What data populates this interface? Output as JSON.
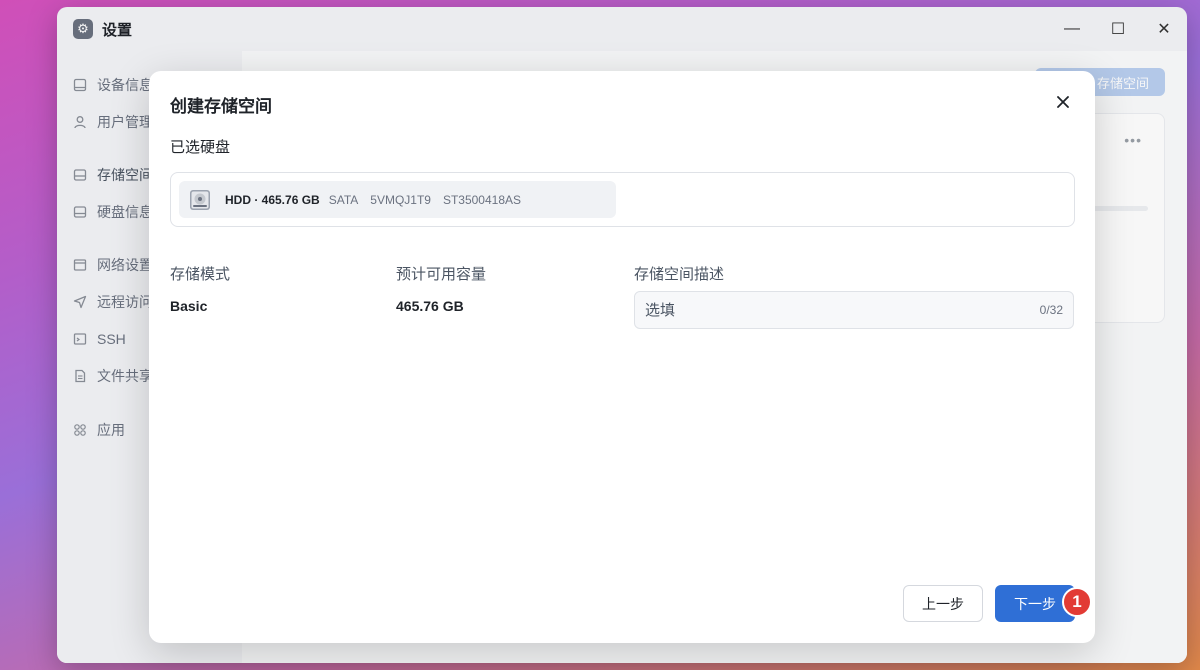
{
  "window": {
    "title": "设置",
    "controls": [
      "—",
      "☐",
      "✕"
    ]
  },
  "sidebar": {
    "items": [
      {
        "label": "设备信息",
        "icon": "monitor-icon"
      },
      {
        "label": "用户管理",
        "icon": "user-icon"
      },
      {
        "label": "存储空间",
        "icon": "storage-icon"
      },
      {
        "label": "硬盘信息",
        "icon": "disk-icon"
      },
      {
        "label": "网络设置",
        "icon": "network-icon"
      },
      {
        "label": "远程访问",
        "icon": "send-icon"
      },
      {
        "label": "SSH",
        "icon": "terminal-icon"
      },
      {
        "label": "文件共享",
        "icon": "file-icon"
      },
      {
        "label": "应用",
        "icon": "apps-icon"
      }
    ]
  },
  "main": {
    "create_button_label": "存储空间"
  },
  "dialog": {
    "title": "创建存储空间",
    "selected_label": "已选硬盘",
    "disk": {
      "main": "HDD · 465.76 GB",
      "interface": "SATA",
      "serial": "5VMQJ1T9",
      "model": "ST3500418AS"
    },
    "mode_label": "存储模式",
    "mode_value": "Basic",
    "capacity_label": "预计可用容量",
    "capacity_value": "465.76 GB",
    "desc_label": "存储空间描述",
    "desc_placeholder": "选填",
    "desc_count": "0/32",
    "prev_label": "上一步",
    "next_label": "下一步",
    "step_badge": "1"
  }
}
